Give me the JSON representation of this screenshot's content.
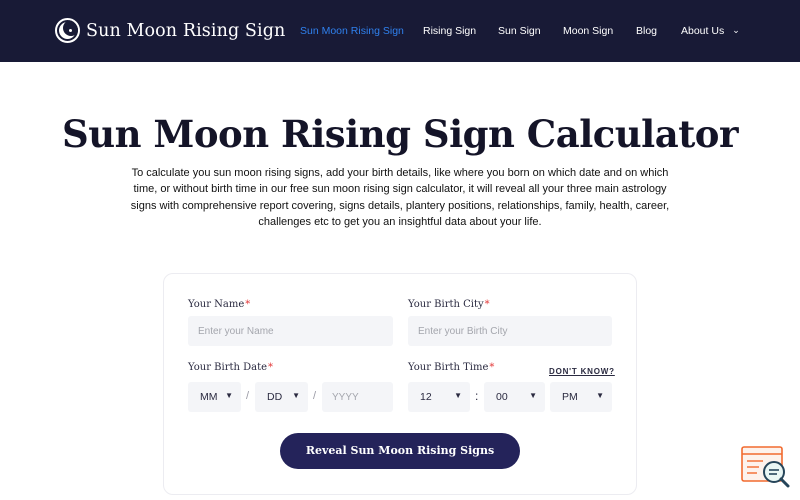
{
  "header": {
    "brand": "Sun Moon Rising Sign",
    "nav": [
      {
        "label": "Sun Moon Rising Sign",
        "active": true
      },
      {
        "label": "Rising Sign",
        "active": false
      },
      {
        "label": "Sun Sign",
        "active": false
      },
      {
        "label": "Moon Sign",
        "active": false
      },
      {
        "label": "Blog",
        "active": false
      },
      {
        "label": "About Us",
        "active": false,
        "has_dropdown": true
      }
    ]
  },
  "hero": {
    "title": "Sun Moon Rising Sign Calculator",
    "description": "To calculate you sun moon rising signs, add your birth details, like where you born on which date and on which time, or without birth time in our free sun moon rising sign calculator, it will reveal all your three main astrology signs with comprehensive report covering, signs details, plantery positions, relationships, family, health, career, challenges etc to get you an insightful data about your life."
  },
  "form": {
    "name_label": "Your Name",
    "name_placeholder": "Enter your Name",
    "city_label": "Your Birth City",
    "city_placeholder": "Enter your Birth City",
    "date_label": "Your Birth Date",
    "month_value": "MM",
    "day_value": "DD",
    "year_placeholder": "YYYY",
    "date_separator": "/",
    "time_label": "Your Birth Time",
    "dont_know": "DON'T KNOW?",
    "hour_value": "12",
    "time_separator": ":",
    "minute_value": "00",
    "ampm_value": "PM",
    "required_mark": "*",
    "submit_label": "Reveal Sun Moon Rising Signs"
  },
  "colors": {
    "header_bg": "#181a36",
    "nav_active": "#2f80ed",
    "button_bg": "#24235a",
    "required": "#e23636"
  },
  "icons": {
    "brand": "crescent-moon-icon",
    "dropdown": "chevron-down-icon",
    "widget": "search-document-icon"
  }
}
